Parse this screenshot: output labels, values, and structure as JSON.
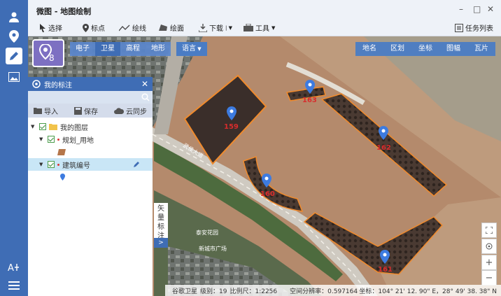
{
  "window": {
    "title": "微图 - 地图绘制",
    "controls": {
      "minimize": "–",
      "maximize": "□",
      "close": "✕"
    }
  },
  "toolbar": {
    "select": "选择",
    "marker": "标点",
    "line": "绘线",
    "area": "绘面",
    "download": "下载",
    "tools": "工具",
    "tasks": "任务列表"
  },
  "map_types": [
    "电子",
    "卫星",
    "高程",
    "地形"
  ],
  "active_map_type": "卫星",
  "language": "语言",
  "map_tools": [
    "地名",
    "区划",
    "坐标",
    "图幅",
    "瓦片"
  ],
  "panel": {
    "title": "我的标注",
    "import": "导入",
    "save": "保存",
    "sync": "云同步",
    "tree": {
      "root": "我的图层",
      "layer1": "规划_用地",
      "layer2": "建筑编号"
    }
  },
  "side_tab": {
    "text": [
      "矢",
      "量",
      "标",
      "注"
    ],
    "expand": ">"
  },
  "map_labels": {
    "plot_159": "159",
    "plot_161": "161",
    "plot_162": "162",
    "plot_160": "160",
    "plot_163": "163",
    "road_text": "武侯大道",
    "poi1": "泰安花园",
    "poi2": "新城市广场"
  },
  "status": {
    "source": "谷歌卫星",
    "level": "级别：19",
    "scale": "比例尺：1:2256",
    "resolution": "空间分辨率：0.597164",
    "coords": "坐标：104° 21' 12. 90\" E，28° 49' 38. 38\" N"
  },
  "colors": {
    "sidebar": "#3f6db5",
    "accent": "#4a7cc4",
    "plot_outline": "#f08a2c",
    "pin": "#3d7be0",
    "label": "#d82c2c"
  }
}
